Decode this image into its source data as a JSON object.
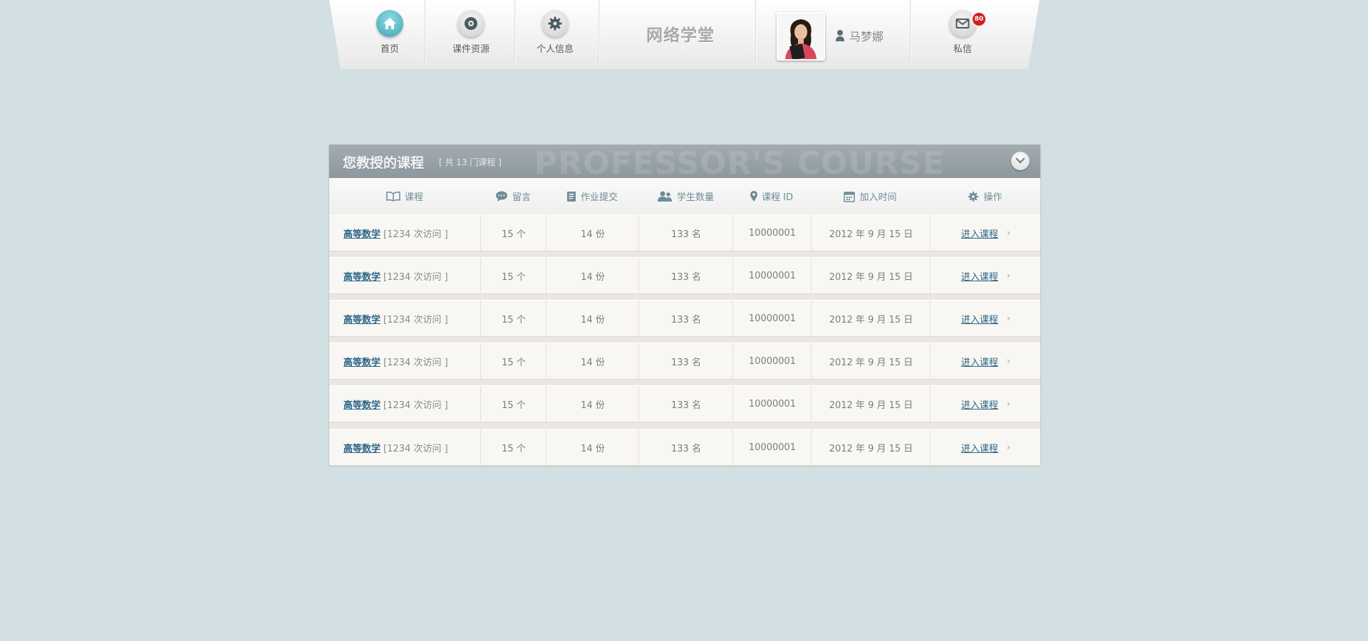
{
  "nav": {
    "items": [
      {
        "label": "首页",
        "icon": "home-icon"
      },
      {
        "label": "课件资源",
        "icon": "disc-icon"
      },
      {
        "label": "个人信息",
        "icon": "gear-icon"
      }
    ],
    "site_title": "网络学堂",
    "user_name": "马梦娜",
    "messages_label": "私信",
    "messages_badge": "80"
  },
  "panel": {
    "title": "您教授的课程",
    "count": "[ 共 13 门课程 ]",
    "watermark": "PROFESSOR'S COURSE",
    "columns": [
      "课程",
      "留言",
      "作业提交",
      "学生数量",
      "课程 ID",
      "加入时间",
      "操作"
    ],
    "rows": [
      {
        "course": "高等数学",
        "visits": "[1234 次访问 ]",
        "messages": "15 个",
        "homework": "14 份",
        "students": "133 名",
        "id": "10000001",
        "joined": "2012 年 9 月 15 日",
        "action": "进入课程"
      },
      {
        "course": "高等数学",
        "visits": "[1234 次访问 ]",
        "messages": "15 个",
        "homework": "14 份",
        "students": "133 名",
        "id": "10000001",
        "joined": "2012 年 9 月 15 日",
        "action": "进入课程"
      },
      {
        "course": "高等数学",
        "visits": "[1234 次访问 ]",
        "messages": "15 个",
        "homework": "14 份",
        "students": "133 名",
        "id": "10000001",
        "joined": "2012 年 9 月 15 日",
        "action": "进入课程"
      },
      {
        "course": "高等数学",
        "visits": "[1234 次访问 ]",
        "messages": "15 个",
        "homework": "14 份",
        "students": "133 名",
        "id": "10000001",
        "joined": "2012 年 9 月 15 日",
        "action": "进入课程"
      },
      {
        "course": "高等数学",
        "visits": "[1234 次访问 ]",
        "messages": "15 个",
        "homework": "14 份",
        "students": "133 名",
        "id": "10000001",
        "joined": "2012 年 9 月 15 日",
        "action": "进入课程"
      },
      {
        "course": "高等数学",
        "visits": "[1234 次访问 ]",
        "messages": "15 个",
        "homework": "14 份",
        "students": "133 名",
        "id": "10000001",
        "joined": "2012 年 9 月 15 日",
        "action": "进入课程"
      }
    ]
  },
  "colors": {
    "background": "#d2dfe3",
    "header": "#959fa5",
    "link": "#2f6686",
    "badge": "#d21e1e",
    "home_icon": "#4fb3c0"
  }
}
